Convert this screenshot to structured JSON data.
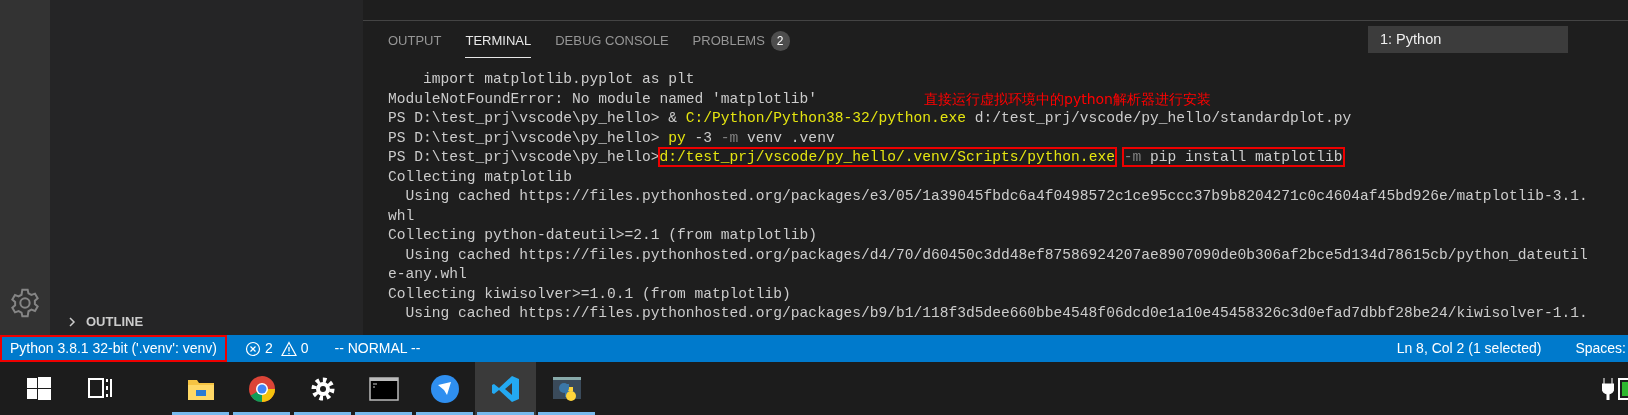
{
  "sidebar": {
    "section": {
      "label": "OUTLINE",
      "expanded": false
    }
  },
  "panel": {
    "tabs": [
      {
        "label": "OUTPUT",
        "selected": false
      },
      {
        "label": "TERMINAL",
        "selected": true
      },
      {
        "label": "DEBUG CONSOLE",
        "selected": false
      },
      {
        "label": "PROBLEMS",
        "selected": false,
        "badge": "2"
      }
    ],
    "terminal_select": "1: Python",
    "annotation": "直接运行虚拟环境中的python解析器进行安装",
    "lines": [
      [
        {
          "text": "    import matplotlib.pyplot as plt",
          "kind": "output"
        }
      ],
      [
        {
          "text": "ModuleNotFoundError: No module named 'matplotlib'",
          "kind": "output"
        }
      ],
      [
        {
          "text": "PS D:\\test_prj\\vscode\\py_hello> & ",
          "kind": "output"
        },
        {
          "text": "C:/Python/Python38-32/python.exe",
          "kind": "command"
        },
        {
          "text": " d:/test_prj/vscode/py_hello/standardplot.py",
          "kind": "output"
        }
      ],
      [
        {
          "text": "PS D:\\test_prj\\vscode\\py_hello> ",
          "kind": "output"
        },
        {
          "text": "py",
          "kind": "command"
        },
        {
          "text": " -3 ",
          "kind": "output"
        },
        {
          "text": "-m",
          "kind": "flag"
        },
        {
          "text": " venv .venv",
          "kind": "output"
        }
      ],
      [
        {
          "text": "PS D:\\test_prj\\vscode\\py_hello>",
          "kind": "output"
        },
        {
          "kind": "boxed",
          "parts": [
            {
              "text": "d:/test_prj/vscode/py_hello/.venv/Scripts/python.exe",
              "kind": "command"
            }
          ]
        },
        {
          "kind": "boxed",
          "parts": [
            {
              "text": "-m",
              "kind": "flag"
            },
            {
              "text": " pip install matplotlib",
              "kind": "output"
            }
          ]
        }
      ],
      [
        {
          "text": "Collecting matplotlib",
          "kind": "output"
        }
      ],
      [
        {
          "text": "  Using cached https://files.pythonhosted.org/packages/e3/05/1a39045fbdc6a4f0498572c1ce95ccc37b9b8204271c0c4604af45bd926e/matplotlib-3.1.",
          "kind": "output"
        }
      ],
      [
        {
          "text": "whl",
          "kind": "output"
        }
      ],
      [
        {
          "text": "Collecting python-dateutil>=2.1 (from matplotlib)",
          "kind": "output"
        }
      ],
      [
        {
          "text": "  Using cached https://files.pythonhosted.org/packages/d4/70/d60450c3dd48ef87586924207ae8907090de0b306af2bce5d134d78615cb/python_dateutil",
          "kind": "output"
        }
      ],
      [
        {
          "text": "e-any.whl",
          "kind": "output"
        }
      ],
      [
        {
          "text": "Collecting kiwisolver>=1.0.1 (from matplotlib)",
          "kind": "output"
        }
      ],
      [
        {
          "text": "  Using cached https://files.pythonhosted.org/packages/b9/b1/118f3d5dee660bbe4548f06dcd0e1a10e45458326c3d0efad7dbbf28be24/kiwisolver-1.1.",
          "kind": "output"
        }
      ]
    ]
  },
  "status_bar": {
    "interpreter": "Python 3.8.1 32-bit ('.venv': venv)",
    "errors": "2",
    "warnings": "0",
    "mode": "-- NORMAL --",
    "position": "Ln 8, Col 2 (1 selected)",
    "indent": "Spaces:"
  },
  "taskbar": [
    {
      "kind": "start",
      "running": false,
      "selected": false
    },
    {
      "kind": "taskview",
      "running": false,
      "selected": false
    },
    {
      "kind": "explorer",
      "running": true,
      "selected": false
    },
    {
      "kind": "browser",
      "running": true,
      "selected": false
    },
    {
      "kind": "settings",
      "running": true,
      "selected": false
    },
    {
      "kind": "console",
      "running": true,
      "selected": false
    },
    {
      "kind": "bird",
      "running": true,
      "selected": false
    },
    {
      "kind": "editor",
      "running": true,
      "selected": true
    },
    {
      "kind": "python",
      "running": true,
      "selected": false
    }
  ]
}
